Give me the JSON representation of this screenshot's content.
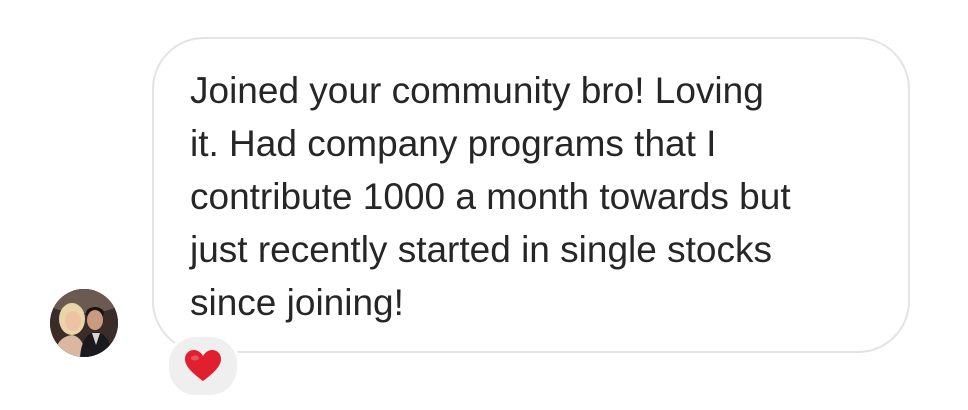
{
  "message": {
    "lines": [
      "Joined your community bro! Loving",
      "it. Had company programs that I",
      "contribute 1000 a month towards but",
      "just recently started in single stocks",
      "since joining!"
    ]
  },
  "sender": {
    "avatar_icon": "profile-photo"
  },
  "reaction": {
    "icon": "red-heart-icon",
    "color": "#e0202e",
    "background": "#efefef"
  },
  "colors": {
    "text": "#262626",
    "bubble_border": "#e3e3e3"
  }
}
